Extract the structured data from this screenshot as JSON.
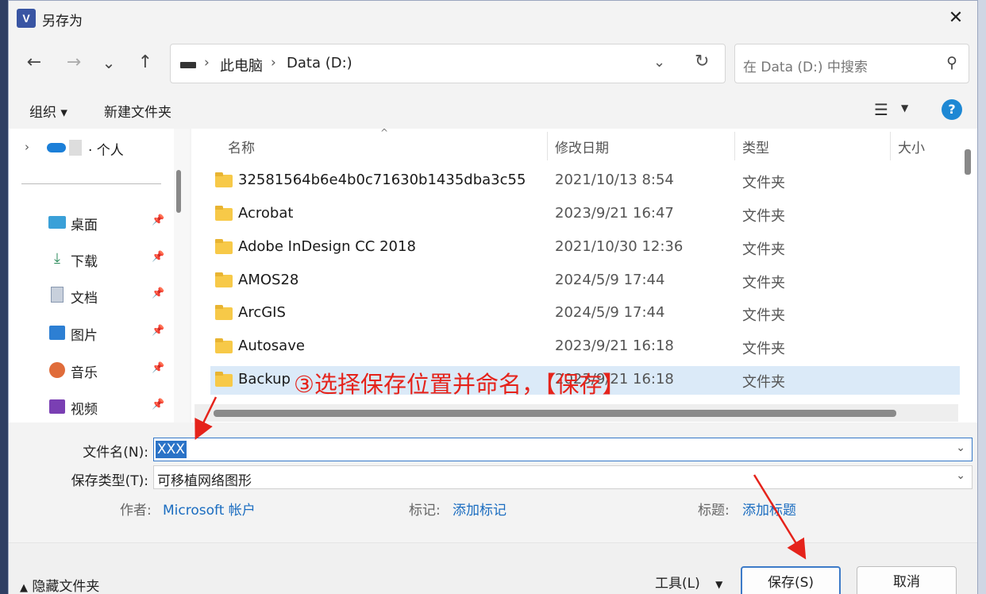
{
  "window": {
    "title": "另存为",
    "app_icon_letter": "V"
  },
  "nav": {
    "back_icon": "←",
    "forward_icon": "→",
    "recent_icon": "⌄",
    "up_icon": "↑",
    "address": {
      "crumbs": [
        "此电脑",
        "Data (D:)"
      ],
      "separator": "›"
    },
    "search_placeholder": "在 Data (D:) 中搜索"
  },
  "toolbar": {
    "organize_label": "组织 ▾",
    "new_folder_label": "新建文件夹",
    "help_label": "?"
  },
  "sidebar": {
    "onedrive_label": "· 个人",
    "items": [
      {
        "label": "桌面",
        "icon": "desktop-icon"
      },
      {
        "label": "下载",
        "icon": "download-icon"
      },
      {
        "label": "文档",
        "icon": "document-icon"
      },
      {
        "label": "图片",
        "icon": "pictures-icon"
      },
      {
        "label": "音乐",
        "icon": "music-icon"
      },
      {
        "label": "视频",
        "icon": "video-icon"
      }
    ]
  },
  "columns": {
    "name": "名称",
    "modified": "修改日期",
    "type": "类型",
    "size": "大小"
  },
  "files": [
    {
      "name": "32581564b6e4b0c71630b1435dba3c55",
      "date": "2021/10/13 8:54",
      "type": "文件夹"
    },
    {
      "name": "Acrobat",
      "date": "2023/9/21 16:47",
      "type": "文件夹"
    },
    {
      "name": "Adobe InDesign CC 2018",
      "date": "2021/10/30 12:36",
      "type": "文件夹"
    },
    {
      "name": "AMOS28",
      "date": "2024/5/9 17:44",
      "type": "文件夹"
    },
    {
      "name": "ArcGIS",
      "date": "2024/5/9 17:44",
      "type": "文件夹"
    },
    {
      "name": "Autosave",
      "date": "2023/9/21 16:18",
      "type": "文件夹"
    },
    {
      "name": "Backup",
      "date": "2023/9/21 16:18",
      "type": "文件夹",
      "selected": true
    }
  ],
  "form": {
    "filename_label": "文件名(N):",
    "filename_value": "XXX",
    "filetype_label": "保存类型(T):",
    "filetype_value": "可移植网络图形",
    "author_label": "作者:",
    "author_value": "Microsoft 帐户",
    "tags_label": "标记:",
    "tags_value": "添加标记",
    "title_label": "标题:",
    "title_value": "添加标题"
  },
  "footer": {
    "hide_folders_label": "隐藏文件夹",
    "tools_label": "工具(L)",
    "save_label": "保存(S)",
    "cancel_label": "取消"
  },
  "annotation": {
    "text": "③选择保存位置并命名，【保存】",
    "color": "#e5231b"
  },
  "colors": {
    "accent": "#2b73c7",
    "link": "#1a6cc0",
    "selection": "#dbeaf8",
    "folder": "#f7c948"
  }
}
